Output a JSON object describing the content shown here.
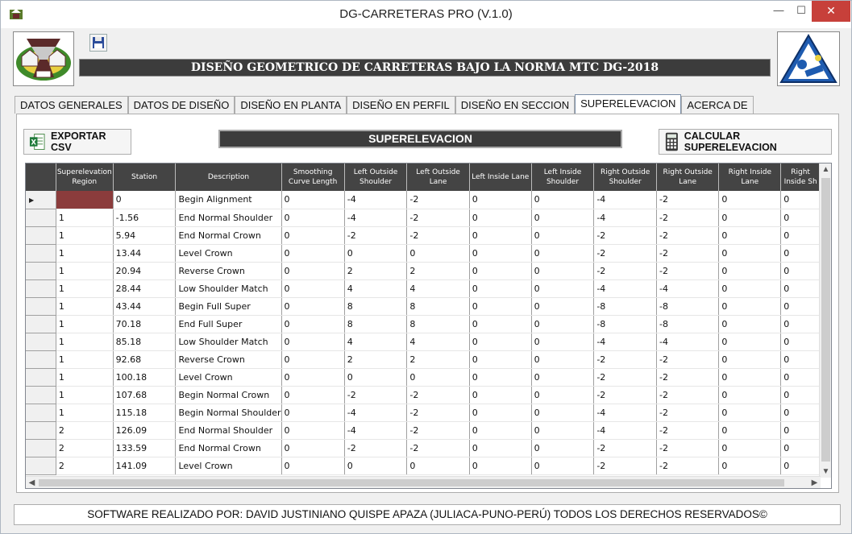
{
  "window": {
    "title": "DG-CARRETERAS PRO (V.1.0)",
    "minimize": "—",
    "maximize": "☐",
    "close": "✕"
  },
  "header": {
    "banner": "DISEÑO GEOMETRICO DE CARRETERAS BAJO LA NORMA MTC DG-2018"
  },
  "tabs": [
    {
      "label": "DATOS GENERALES"
    },
    {
      "label": "DATOS DE DISEÑO"
    },
    {
      "label": "DISEÑO EN PLANTA"
    },
    {
      "label": "DISEÑO EN PERFIL"
    },
    {
      "label": "DISEÑO EN SECCION"
    },
    {
      "label": "SUPERELEVACION"
    },
    {
      "label": "ACERCA DE"
    }
  ],
  "active_tab": "SUPERELEVACION",
  "toolbar": {
    "export_label": "EXPORTAR CSV",
    "section_title": "SUPERELEVACION",
    "calc_label": "CALCULAR SUPERELEVACION"
  },
  "grid": {
    "columns": [
      "Superelevation Region",
      "Station",
      "Description",
      "Smoothing Curve Length",
      "Left Outside Shoulder",
      "Left Outside Lane",
      "Left Inside Lane",
      "Left Inside Shoulder",
      "Right Outside Shoulder",
      "Right Outside Lane",
      "Right Inside Lane",
      "Right Inside Sh"
    ],
    "rows": [
      [
        "",
        "0",
        "Begin Alignment",
        "0",
        "-4",
        "-2",
        "0",
        "0",
        "-4",
        "-2",
        "0",
        "0"
      ],
      [
        "1",
        "-1.56",
        "End Normal Shoulder",
        "0",
        "-4",
        "-2",
        "0",
        "0",
        "-4",
        "-2",
        "0",
        "0"
      ],
      [
        "1",
        "5.94",
        "End Normal Crown",
        "0",
        "-2",
        "-2",
        "0",
        "0",
        "-2",
        "-2",
        "0",
        "0"
      ],
      [
        "1",
        "13.44",
        "Level Crown",
        "0",
        "0",
        "0",
        "0",
        "0",
        "-2",
        "-2",
        "0",
        "0"
      ],
      [
        "1",
        "20.94",
        "Reverse Crown",
        "0",
        "2",
        "2",
        "0",
        "0",
        "-2",
        "-2",
        "0",
        "0"
      ],
      [
        "1",
        "28.44",
        "Low Shoulder Match",
        "0",
        "4",
        "4",
        "0",
        "0",
        "-4",
        "-4",
        "0",
        "0"
      ],
      [
        "1",
        "43.44",
        "Begin Full Super",
        "0",
        "8",
        "8",
        "0",
        "0",
        "-8",
        "-8",
        "0",
        "0"
      ],
      [
        "1",
        "70.18",
        "End Full Super",
        "0",
        "8",
        "8",
        "0",
        "0",
        "-8",
        "-8",
        "0",
        "0"
      ],
      [
        "1",
        "85.18",
        "Low Shoulder Match",
        "0",
        "4",
        "4",
        "0",
        "0",
        "-4",
        "-4",
        "0",
        "0"
      ],
      [
        "1",
        "92.68",
        "Reverse Crown",
        "0",
        "2",
        "2",
        "0",
        "0",
        "-2",
        "-2",
        "0",
        "0"
      ],
      [
        "1",
        "100.18",
        "Level Crown",
        "0",
        "0",
        "0",
        "0",
        "0",
        "-2",
        "-2",
        "0",
        "0"
      ],
      [
        "1",
        "107.68",
        "Begin Normal Crown",
        "0",
        "-2",
        "-2",
        "0",
        "0",
        "-2",
        "-2",
        "0",
        "0"
      ],
      [
        "1",
        "115.18",
        "Begin Normal Shoulder",
        "0",
        "-4",
        "-2",
        "0",
        "0",
        "-4",
        "-2",
        "0",
        "0"
      ],
      [
        "2",
        "126.09",
        "End Normal Shoulder",
        "0",
        "-4",
        "-2",
        "0",
        "0",
        "-4",
        "-2",
        "0",
        "0"
      ],
      [
        "2",
        "133.59",
        "End Normal Crown",
        "0",
        "-2",
        "-2",
        "0",
        "0",
        "-2",
        "-2",
        "0",
        "0"
      ],
      [
        "2",
        "141.09",
        "Level Crown",
        "0",
        "0",
        "0",
        "0",
        "0",
        "-2",
        "-2",
        "0",
        "0"
      ]
    ]
  },
  "footer": {
    "text": "SOFTWARE REALIZADO POR: DAVID JUSTINIANO QUISPE APAZA (JULIACA-PUNO-PERÚ) TODOS LOS DERECHOS RESERVADOS©"
  }
}
